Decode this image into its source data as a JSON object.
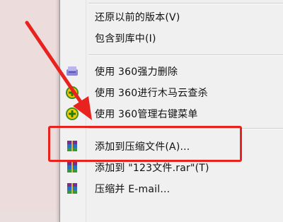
{
  "menu": {
    "items": [
      {
        "label": "还原以前的版本(V)",
        "icon": ""
      },
      {
        "label": "包含到库中(I)",
        "icon": ""
      },
      {
        "label": "使用 360强力删除",
        "icon": "shredder-icon"
      },
      {
        "label": "使用 360进行木马云查杀",
        "icon": "360-shield-icon"
      },
      {
        "label": "使用 360管理右键菜单",
        "icon": "360-plus-icon"
      },
      {
        "label": "添加到压缩文件(A)...",
        "icon": "winrar-icon"
      },
      {
        "label": "添加到 \"123文件.rar\"(T)",
        "icon": "winrar-icon"
      },
      {
        "label": "压缩并 E-mail...",
        "icon": "winrar-icon"
      }
    ]
  },
  "colors": {
    "annotation_red": "#e8231f",
    "menu_bg": "#f0f0f0"
  }
}
